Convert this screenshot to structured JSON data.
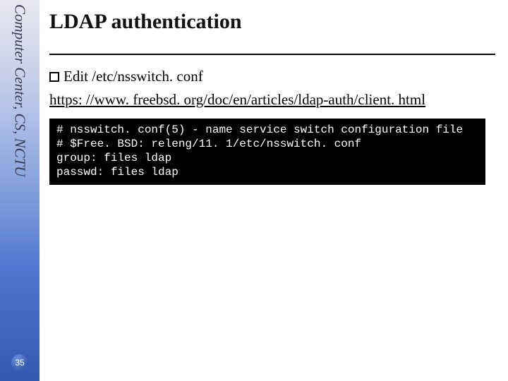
{
  "sidebar": {
    "label": "Computer Center, CS, NCTU",
    "page_number": "35"
  },
  "slide": {
    "title": "LDAP authentication",
    "bullet_text": "Edit /etc/nsswitch. conf",
    "link_text": "https: //www. freebsd. org/doc/en/articles/ldap-auth/client. html",
    "code": "# nsswitch. conf(5) - name service switch configuration file\n# $Free. BSD: releng/11. 1/etc/nsswitch. conf\ngroup: files ldap\npasswd: files ldap"
  }
}
